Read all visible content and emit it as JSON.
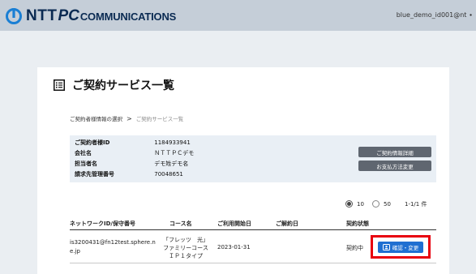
{
  "header": {
    "logo_ntt": "NTT",
    "logo_pc": "PC",
    "logo_comm": "COMMUNICATIONS",
    "user_id": "blue_demo_id001@nt ∙"
  },
  "page": {
    "title": "ご契約サービス一覧"
  },
  "breadcrumb": {
    "item1": "ご契約者様情報の選択",
    "separator": ">",
    "current": "ご契約サービス一覧"
  },
  "contract_info": {
    "rows": [
      {
        "label": "ご契約者様ID",
        "value": "1184933941"
      },
      {
        "label": "会社名",
        "value": "ＮＴＴＰＣデモ"
      },
      {
        "label": "担当者名",
        "value": "デモ姓デモ名"
      },
      {
        "label": "請求先管理番号",
        "value": "70048651"
      }
    ],
    "details_button": "ご契約情報詳細",
    "payment_button": "お支払方法変更"
  },
  "pagination": {
    "option_10": "10",
    "option_50": "50",
    "selected": "10",
    "range": "1-1/1 件"
  },
  "table": {
    "headers": {
      "network_id": "ネットワークID/保守番号",
      "course": "コース名",
      "start_date": "ご利用開始日",
      "cancel_date": "ご解約日",
      "status": "契約状態"
    },
    "rows": [
      {
        "network_id_line1": "is3200431@fn12test.sphere.n",
        "network_id_line2": "e.jp",
        "course_line1": "「フレッツ　光」",
        "course_line2": "ファミリーコース",
        "course_line3": "ＩＰ１タイプ",
        "start_date": "2023-01-31",
        "cancel_date": "",
        "status": "契約中",
        "action_label": "確認・変更"
      }
    ]
  },
  "colors": {
    "topbar": "#c5ced8",
    "background": "#eaeef2",
    "brand_navy": "#0a2a52",
    "logo_blue": "#1a7fd4",
    "panel": "#e9eff5",
    "panel_button": "#5f6670",
    "primary_button": "#1f6fd1",
    "highlight": "#e8000e"
  },
  "icons": {
    "logo": "ntt-logo-icon",
    "title": "list-icon",
    "action": "id-card-icon"
  }
}
